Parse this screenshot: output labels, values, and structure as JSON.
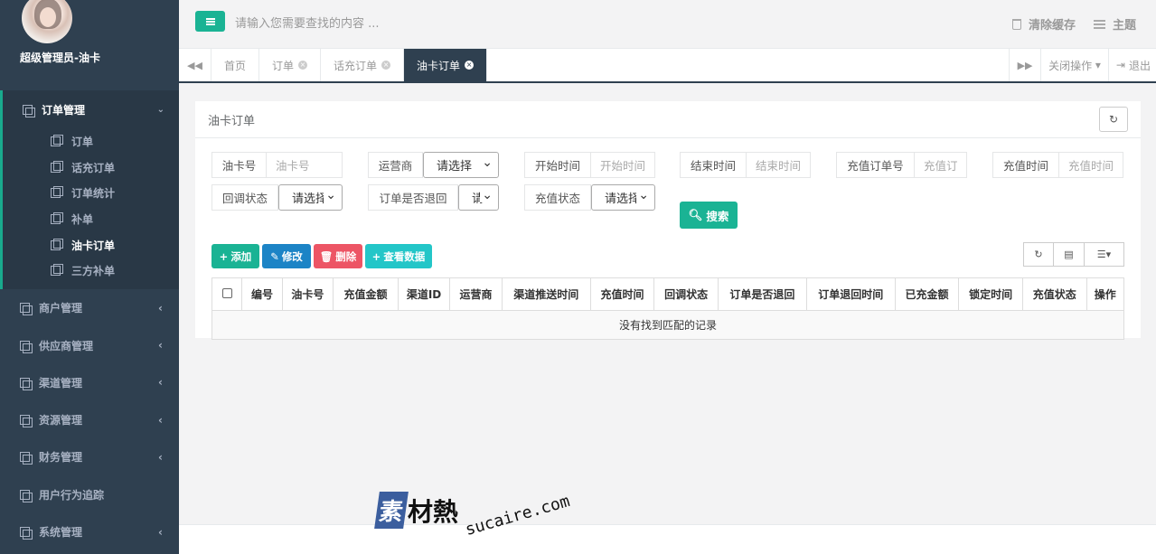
{
  "profile": {
    "name": "超级管理员-油卡"
  },
  "sidebar": {
    "group": {
      "label": "订单管理",
      "items": [
        "订单",
        "话充订单",
        "订单统计",
        "补单",
        "油卡订单",
        "三方补单"
      ]
    },
    "items": [
      "商户管理",
      "供应商管理",
      "渠道管理",
      "资源管理",
      "财务管理",
      "用户行为追踪",
      "系统管理"
    ]
  },
  "topbar": {
    "search_placeholder": "请输入您需要查找的内容 ...",
    "clear_cache": "清除缓存",
    "theme": "主题"
  },
  "tabs": {
    "items": [
      "首页",
      "订单",
      "话充订单",
      "油卡订单"
    ],
    "close_ops": "关闭操作",
    "logout": "退出"
  },
  "panel": {
    "title": "油卡订单",
    "filters": {
      "card_no_label": "油卡号",
      "card_no_placeholder": "油卡号",
      "operator_label": "运营商",
      "operator_value": "请选择",
      "start_label": "开始时间",
      "start_placeholder": "开始时间",
      "end_label": "结束时间",
      "end_placeholder": "结束时间",
      "order_no_label": "充值订单号",
      "order_no_placeholder": "充值订",
      "recharge_time_label": "充值时间",
      "recharge_time_placeholder": "充值时间",
      "callback_label": "回调状态",
      "callback_value": "请选择",
      "returned_label": "订单是否退回",
      "returned_value": "请",
      "recharge_status_label": "充值状态",
      "recharge_status_value": "请选择"
    },
    "search_button": "搜索",
    "toolbar": {
      "add": "添加",
      "edit": "修改",
      "delete": "删除",
      "view": "查看数据"
    },
    "table": {
      "columns": [
        "编号",
        "油卡号",
        "充值金额",
        "渠道ID",
        "运营商",
        "渠道推送时间",
        "充值时间",
        "回调状态",
        "订单是否退回",
        "订单退回时间",
        "已充金额",
        "锁定时间",
        "充值状态",
        "操作"
      ],
      "empty_text": "没有找到匹配的记录"
    }
  },
  "watermark": {
    "box": "素",
    "text": "材熱",
    "url": "sucaire.com"
  }
}
